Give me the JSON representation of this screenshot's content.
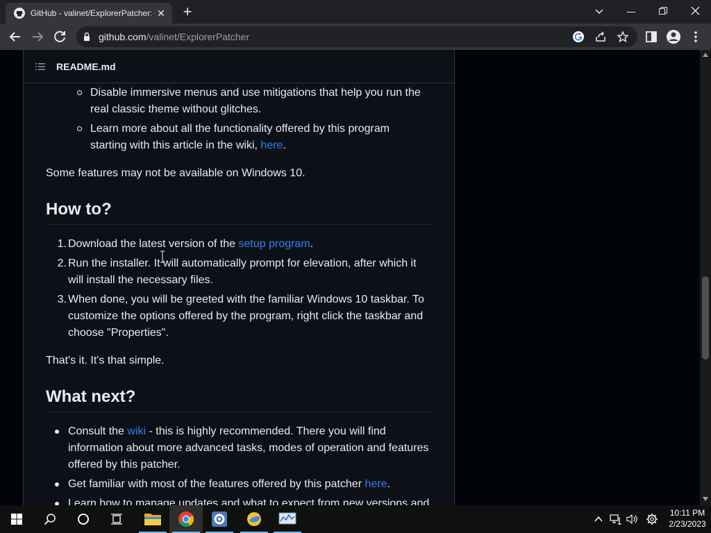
{
  "browser": {
    "tab_title": "GitHub - valinet/ExplorerPatcher: T",
    "url_host": "github.com",
    "url_path": "/valinet/ExplorerPatcher",
    "accent": "#35363a"
  },
  "readme": {
    "title": "README.md",
    "sub_items": [
      {
        "line1": "Disable immersive menus and use mitigations that help you run the",
        "line2": "real classic theme without glitches."
      },
      {
        "line1": "Learn more about all the functionality offered by this program",
        "line2_prefix": "starting with this article in the wiki, ",
        "line2_link": "here",
        "line2_suffix": "."
      }
    ],
    "note": "Some features may not be available on Windows 10.",
    "howto_heading": "How to?",
    "steps": [
      {
        "num": "1.",
        "prefix": "Download the latest version of the ",
        "link": "setup program",
        "suffix": "."
      },
      {
        "num": "2.",
        "line1": "Run the installer. It will automatically prompt for elevation, after which it",
        "line2": "will install the necessary files."
      },
      {
        "num": "3.",
        "line1": "When done, you will be greeted with the familiar Windows 10 taskbar. To",
        "line2": "customize the options offered by the program, right click the taskbar and",
        "line3": "choose \"Properties\"."
      }
    ],
    "simple": "That's it. It's that simple.",
    "next_heading": "What next?",
    "next_items": [
      {
        "prefix": "Consult the ",
        "link": "wiki",
        "suffix": " - this is highly recommended. There you will find",
        "line2": "information about more advanced tasks, modes of operation and features",
        "line3": "offered by this patcher."
      },
      {
        "prefix": "Get familiar with most of the features offered by this patcher ",
        "link": "here",
        "suffix": "."
      },
      {
        "line1": "Learn how to manage updates and what to expect from new versions and"
      }
    ],
    "link_color": "#2f81f7"
  },
  "taskbar": {
    "time": "10:11 PM",
    "date": "2/23/2023"
  }
}
